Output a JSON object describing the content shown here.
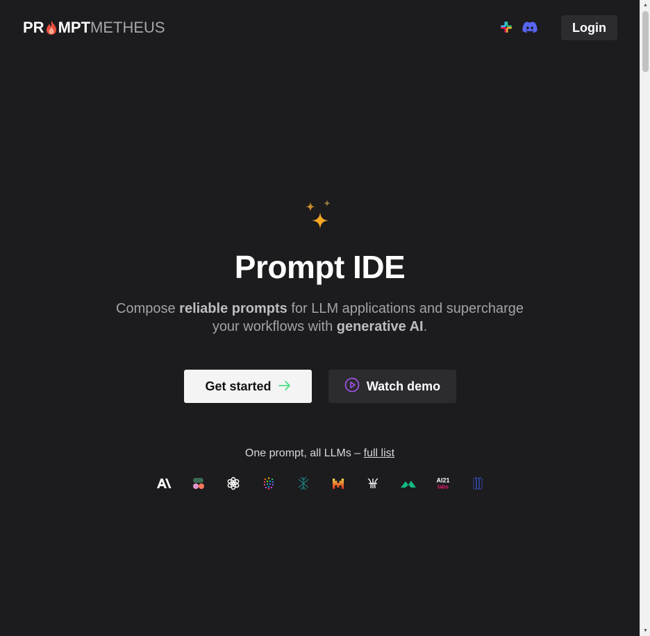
{
  "header": {
    "logo": {
      "part1": "PR",
      "part2": "MPT",
      "part3": "METHEUS"
    },
    "icons": [
      "slack-icon",
      "discord-icon"
    ],
    "login_label": "Login"
  },
  "hero": {
    "icon": "sparkles-icon",
    "title": "Prompt IDE",
    "subtitle": {
      "t1": "Compose ",
      "b1": "reliable prompts",
      "t2": " for LLM applications and supercharge your workflows with ",
      "b2": "generative AI",
      "t3": "."
    },
    "primary_button": {
      "label": "Get started",
      "icon": "arrow-right-icon"
    },
    "secondary_button": {
      "label": "Watch demo",
      "icon": "play-circle-icon"
    }
  },
  "llms": {
    "text": "One prompt, all LLMs – ",
    "link": "full list",
    "logos": [
      "anthropic-icon",
      "cohere-icon",
      "openai-icon",
      "aleph-alpha-icon",
      "deepseek-icon",
      "mistral-icon",
      "perplexity-icon",
      "groq-icon",
      "ai21-labs-icon",
      "gemini-icon"
    ]
  },
  "colors": {
    "background": "#1c1b1e",
    "accent_spark": "#f5a623",
    "flame": "#e94e3c",
    "play_purple": "#a855f7",
    "arrow_green": "#4ade80"
  }
}
